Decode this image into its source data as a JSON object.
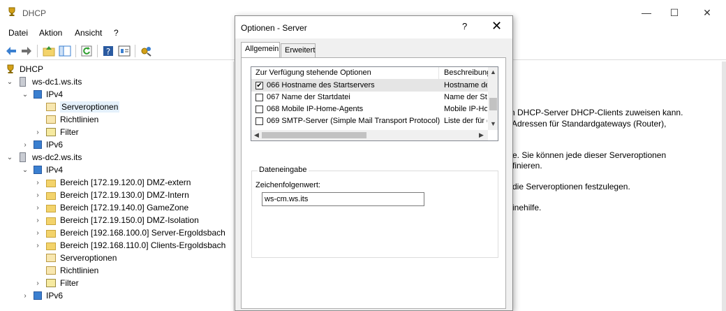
{
  "window": {
    "title": "DHCP"
  },
  "window_controls": {
    "minimize": "—",
    "maximize": "☐",
    "close": "✕"
  },
  "menu": [
    "Datei",
    "Aktion",
    "Ansicht",
    "?"
  ],
  "tree": [
    {
      "label": "DHCP",
      "icon": "dhcp-trophy-icon"
    },
    {
      "label": "ws-dc1.ws.its",
      "icon": "server-icon"
    },
    {
      "label": "IPv4",
      "icon": "ipv4-icon"
    },
    {
      "label": "Serveroptionen",
      "icon": "server-options-icon"
    },
    {
      "label": "Richtlinien",
      "icon": "policies-icon"
    },
    {
      "label": "Filter",
      "icon": "filter-icon"
    },
    {
      "label": "IPv6",
      "icon": "ipv6-icon"
    },
    {
      "label": "ws-dc2.ws.its",
      "icon": "server-icon"
    },
    {
      "label": "IPv4",
      "icon": "ipv4-icon"
    },
    {
      "label": "Bereich [172.19.120.0] DMZ-extern",
      "icon": "folder-icon"
    },
    {
      "label": "Bereich [172.19.130.0] DMZ-Intern",
      "icon": "folder-icon"
    },
    {
      "label": "Bereich [172.19.140.0] GameZone",
      "icon": "folder-icon"
    },
    {
      "label": "Bereich [172.19.150.0] DMZ-Isolation",
      "icon": "folder-icon"
    },
    {
      "label": "Bereich [192.168.100.0] Server-Ergoldsbach",
      "icon": "folder-icon"
    },
    {
      "label": "Bereich [192.168.110.0] Clients-Ergoldsbach",
      "icon": "folder-icon"
    },
    {
      "label": "Serveroptionen",
      "icon": "server-options-icon"
    },
    {
      "label": "Richtlinien",
      "icon": "policies-icon"
    },
    {
      "label": "Filter",
      "icon": "filter-icon"
    },
    {
      "label": "IPv6",
      "icon": "ipv6-icon"
    }
  ],
  "right_text": [
    "n DHCP-Server DHCP-Clients zuweisen kann.",
    "Adressen für Standardgateways (Router),",
    "e. Sie können jede dieser Serveroptionen",
    "finieren.",
    "die Serveroptionen festzulegen.",
    "inehilfe."
  ],
  "dialog": {
    "title": "Optionen - Server",
    "help": "?",
    "close": "✕",
    "tabs": [
      "Allgemein",
      "Erweitert"
    ],
    "list_headers": [
      "Zur Verfügung stehende Optionen",
      "Beschreibung"
    ],
    "rows": [
      {
        "checked": "✔",
        "name": "066 Hostname des Startservers",
        "desc": "Hostname des"
      },
      {
        "checked": "",
        "name": "067 Name der Startdatei",
        "desc": "Name der Start"
      },
      {
        "checked": "",
        "name": "068 Mobile IP-Home-Agents",
        "desc": "Mobile IP-Hom"
      },
      {
        "checked": "",
        "name": "069 SMTP-Server (Simple Mail Transport Protocol)",
        "desc": "Liste der für d"
      }
    ],
    "group_label": "Dateneingabe",
    "field_label": "Zeichenfolgenwert:",
    "field_value": "ws-cm.ws.its"
  },
  "colors": {
    "selection": "#e5f1fb",
    "accent": "#3a7fd0"
  }
}
